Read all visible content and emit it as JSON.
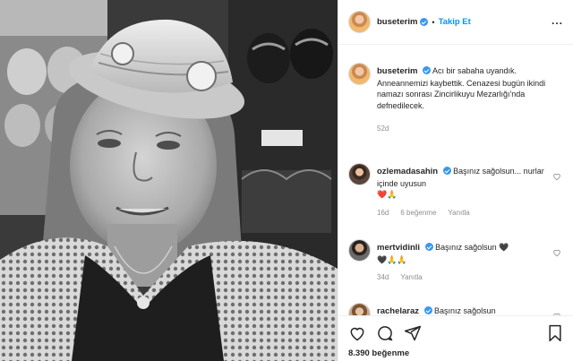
{
  "header": {
    "username": "buseterim",
    "separator": "•",
    "follow_label": "Takip Et",
    "more_icon": "more-options-icon"
  },
  "caption": {
    "username": "buseterim",
    "text": "Acı bir sabaha uyandık. Anneannemizi kaybettik. Cenazesi bugün ikindi namazı sonrası Zincirlikuyu Mezarlığı'nda defnedilecek.",
    "time": "52d"
  },
  "comments": [
    {
      "username": "ozlemadasahin",
      "text": "Başınız sağolsun... nurlar içinde uyusun",
      "emoji": "❤️🙏",
      "time": "16d",
      "likes": "6 beğenme",
      "reply": "Yanıtla"
    },
    {
      "username": "mertvidinli",
      "text": "Başınız sağolsun 🖤",
      "emoji": "🖤🙏🙏",
      "time": "34d",
      "likes": "",
      "reply": "Yanıtla"
    },
    {
      "username": "rachelaraz",
      "text": "Başınız sağolsun",
      "emoji": "",
      "time": "",
      "likes": "",
      "reply": ""
    }
  ],
  "footer": {
    "likes_count": "8.390 beğenme"
  },
  "colors": {
    "verified": "#3897f0",
    "follow": "#0095f6",
    "meta": "#8e8e8e",
    "heart": "#ed2f3a"
  }
}
